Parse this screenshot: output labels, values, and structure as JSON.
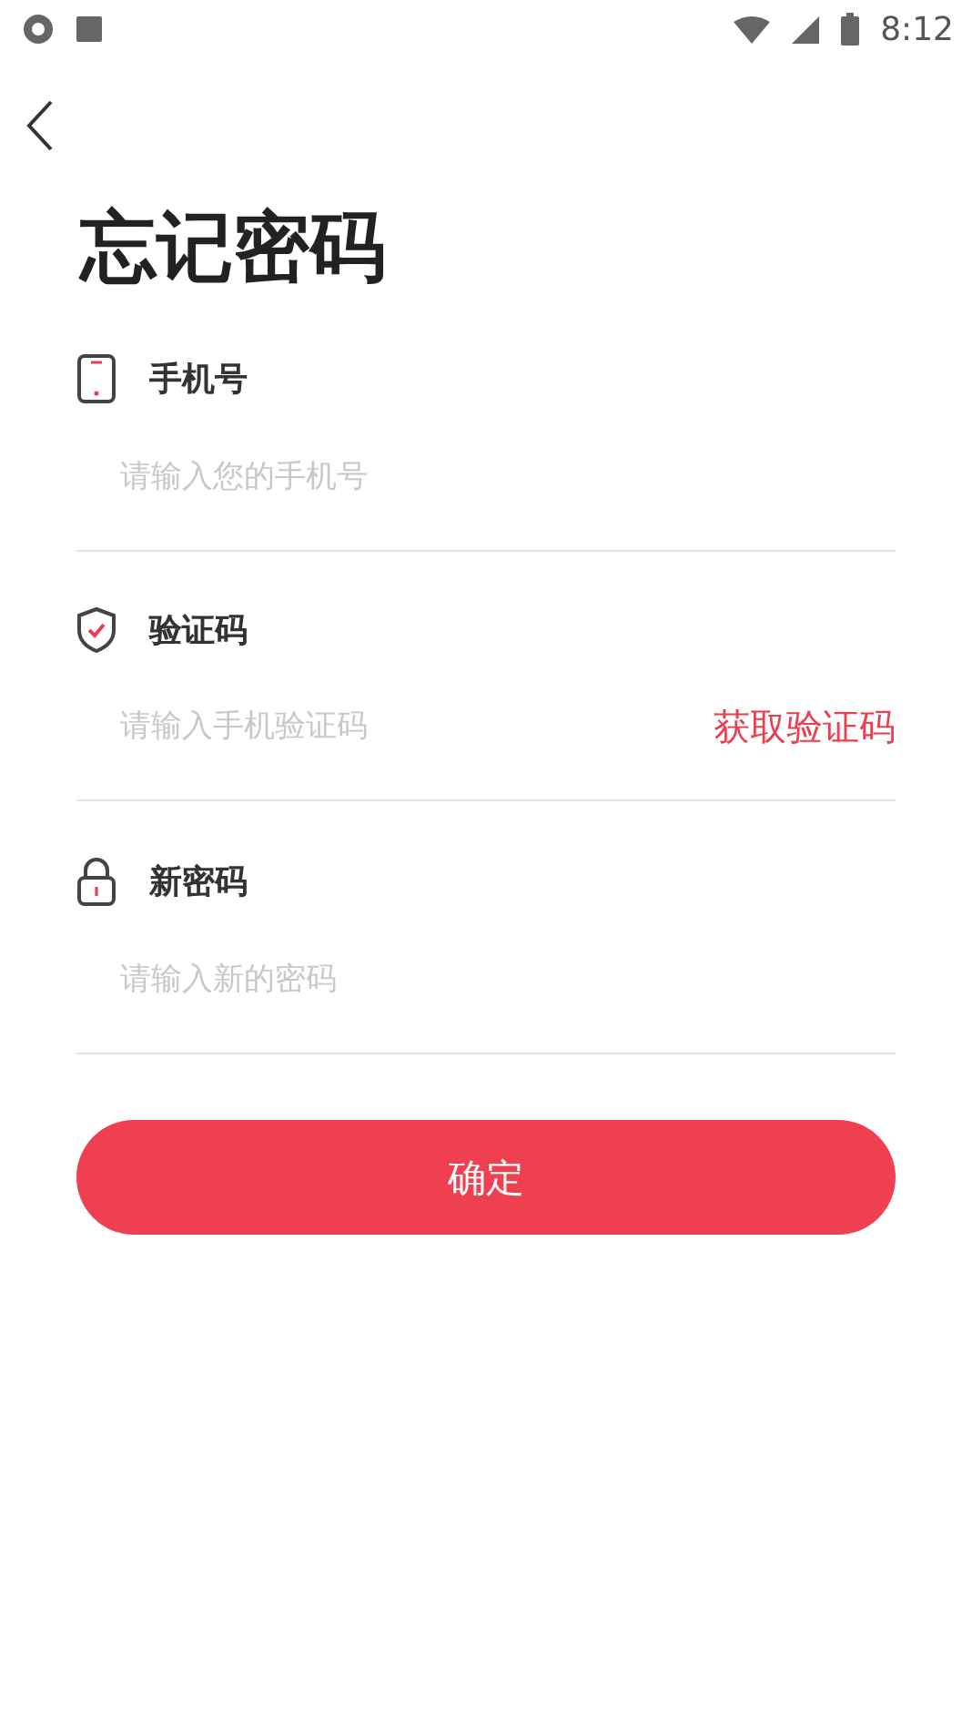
{
  "status_bar": {
    "time": "8:12"
  },
  "title": "忘记密码",
  "fields": [
    {
      "kind": "phone",
      "label": "手机号",
      "placeholder": "请输入您的手机号"
    },
    {
      "kind": "code",
      "label": "验证码",
      "placeholder": "请输入手机验证码",
      "action": "获取验证码"
    },
    {
      "kind": "password",
      "label": "新密码",
      "placeholder": "请输入新的密码"
    }
  ],
  "submit": "确定"
}
